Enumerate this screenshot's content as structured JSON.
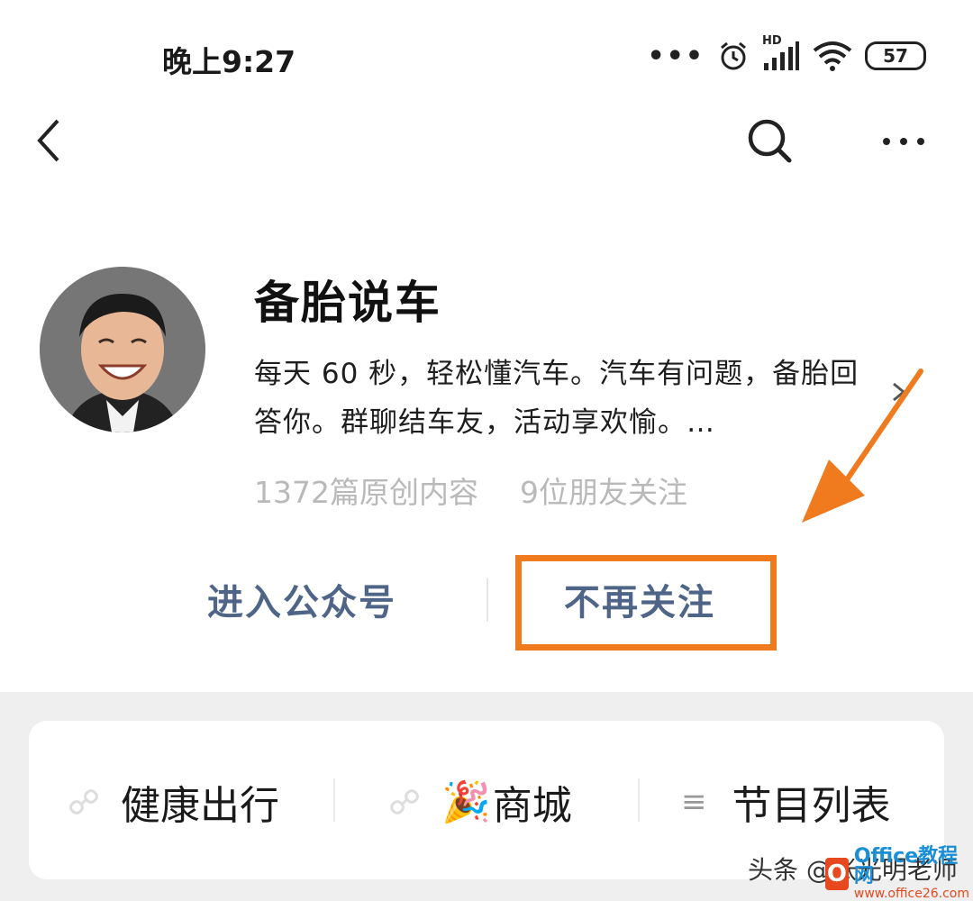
{
  "status_bar": {
    "time": "晚上9:27",
    "dots": "•••",
    "network": "HD",
    "battery": "57"
  },
  "account": {
    "name": "备胎说车",
    "description": "每天 60 秒，轻松懂汽车。汽车有问题，备胎回答你。群聊结车友，活动享欢愉。…",
    "original_count": "1372篇原创内容",
    "friends_following": "9位朋友关注"
  },
  "actions": {
    "enter": "进入公众号",
    "unfollow": "不再关注"
  },
  "menu": {
    "items": [
      {
        "label": "健康出行",
        "icon": "link-icon"
      },
      {
        "label": "商城",
        "icon": "party-popper-icon",
        "emoji": "🎉"
      },
      {
        "label": "节目列表",
        "icon": "list-icon",
        "glyph": "≡"
      }
    ]
  },
  "watermark": {
    "text": "头条 @张光明老师",
    "logo_main": "Office教程网",
    "logo_sub": "www.office26.com"
  },
  "colors": {
    "action_text": "#4f6588",
    "highlight": "#f07a1e",
    "stats_text": "#b9b9b9"
  }
}
